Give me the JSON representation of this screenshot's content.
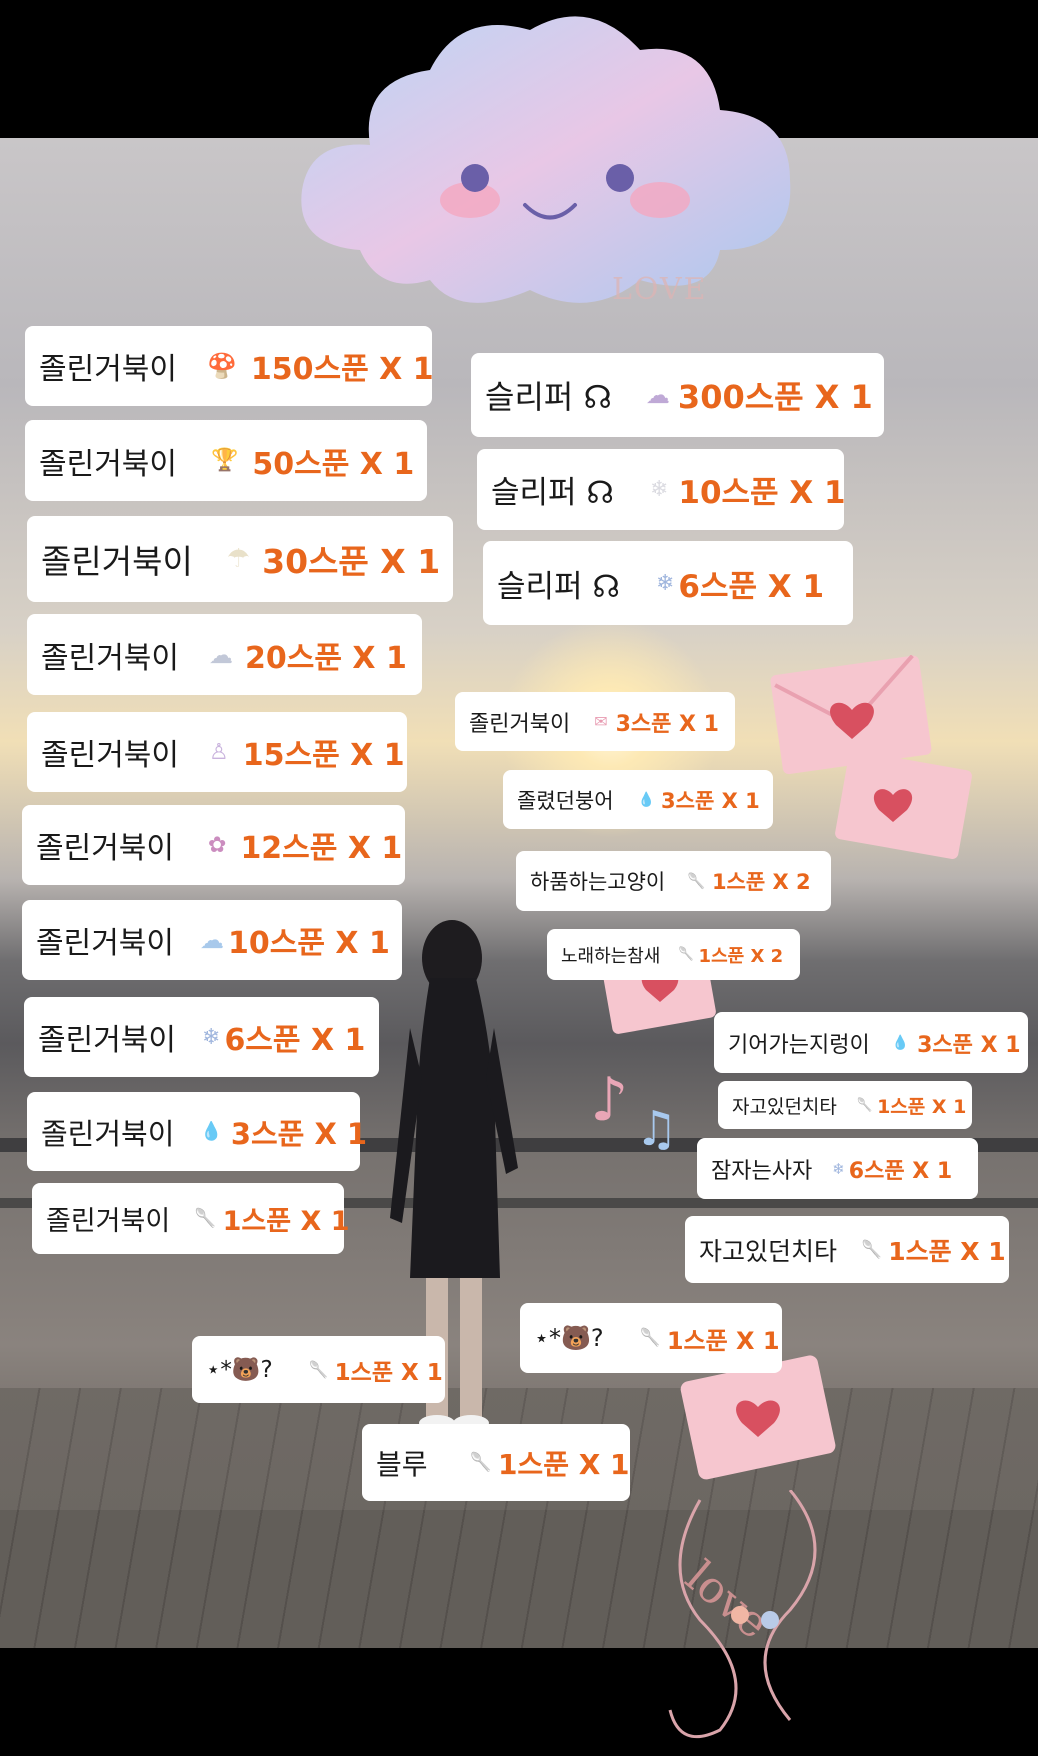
{
  "overlay": {
    "love_text": "LOVE"
  },
  "left_tags": [
    {
      "name": "졸린거북이",
      "icon": "mushroom-icon",
      "glyph": "🍄",
      "amount": "150스푼 X 1"
    },
    {
      "name": "졸린거북이",
      "icon": "trophy-icon",
      "glyph": "🏆",
      "amount": "50스푼 X 1"
    },
    {
      "name": "졸린거북이",
      "icon": "jellyfish-icon",
      "glyph": "☂",
      "amount": "30스푼 X 1"
    },
    {
      "name": "졸린거북이",
      "icon": "cloud-rain-icon",
      "glyph": "☁",
      "amount": "20스푼 X 1"
    },
    {
      "name": "졸린거북이",
      "icon": "unicorn-icon",
      "glyph": "♙",
      "amount": "15스푼 X 1"
    },
    {
      "name": "졸린거북이",
      "icon": "flower-icon",
      "glyph": "✿",
      "amount": "12스푼 X 1"
    },
    {
      "name": "졸린거북이",
      "icon": "rainbow-icon",
      "glyph": "☁",
      "amount": "10스푼 X 1"
    },
    {
      "name": "졸린거북이",
      "icon": "bubbles-icon",
      "glyph": "❄",
      "amount": "6스푼 X 1"
    },
    {
      "name": "졸린거북이",
      "icon": "water-drop-icon",
      "glyph": "💧",
      "amount": "3스푼 X 1"
    },
    {
      "name": "졸린거북이",
      "icon": "spoon-icon",
      "glyph": "🥄",
      "amount": "1스푼 X 1"
    }
  ],
  "right_tags": [
    {
      "name": "슬리퍼 ☊",
      "icon": "cloud-rain-icon",
      "glyph": "☁",
      "amount": "300스푼 X 1"
    },
    {
      "name": "슬리퍼 ☊",
      "icon": "snowflake-icon",
      "glyph": "❄",
      "amount": "10스푼 X 1"
    },
    {
      "name": "슬리퍼 ☊",
      "icon": "bubbles-icon",
      "glyph": "❄",
      "amount": "6스푼 X 1"
    },
    {
      "name": "졸린거북이",
      "icon": "letter-icon",
      "glyph": "✉",
      "amount": "3스푼 X 1"
    },
    {
      "name": "졸렸던붕어",
      "icon": "water-drop-icon",
      "glyph": "💧",
      "amount": "3스푼 X 1"
    },
    {
      "name": "하품하는고양이",
      "icon": "spoon-icon",
      "glyph": "🥄",
      "amount": "1스푼 X 2"
    },
    {
      "name": "노래하는참새",
      "icon": "spoon-icon",
      "glyph": "🥄",
      "amount": "1스푼 X 2"
    },
    {
      "name": "기어가는지렁이",
      "icon": "water-drop-icon",
      "glyph": "💧",
      "amount": "3스푼 X 1"
    },
    {
      "name": "자고있던치타",
      "icon": "spoon-icon",
      "glyph": "🥄",
      "amount": "1스푼 X 1"
    },
    {
      "name": "잠자는사자",
      "icon": "bubbles-icon",
      "glyph": "❄",
      "amount": "6스푼 X 1"
    },
    {
      "name": "자고있던치타",
      "icon": "spoon-icon",
      "glyph": "🥄",
      "amount": "1스푼 X 1"
    }
  ],
  "bottom_tags": [
    {
      "name": "⋆*🐻?",
      "icon": "spoon-icon",
      "glyph": "🥄",
      "amount": "1스푼 X 1"
    },
    {
      "name": "⋆*🐻?",
      "icon": "spoon-icon",
      "glyph": "🥄",
      "amount": "1스푼 X 1"
    },
    {
      "name": "블루",
      "icon": "spoon-icon",
      "glyph": "🥄",
      "amount": "1스푼 X 1"
    }
  ]
}
